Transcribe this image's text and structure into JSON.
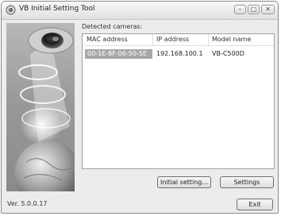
{
  "window": {
    "title": "VB Initial Setting Tool",
    "controls": {
      "minimize": "–",
      "maximize": "□",
      "close": "✕"
    }
  },
  "main": {
    "detected_label": "Detected cameras:",
    "columns": [
      "MAC address",
      "IP address",
      "Model name"
    ],
    "rows": [
      {
        "mac": "00-1E-8F-06-50-5E",
        "ip": "192.168.100.1",
        "model": "VB-C500D",
        "selected": true
      }
    ]
  },
  "buttons": {
    "initial_setting": "Initial setting...",
    "settings": "Settings",
    "exit": "Exit"
  },
  "footer": {
    "version": "Ver. 5.0.0.17"
  },
  "icons": {
    "app": "camera-icon",
    "minimize": "minimize-icon",
    "maximize": "maximize-icon",
    "close": "close-icon"
  },
  "colors": {
    "selection": "#a8a8a8",
    "window_bg": "#ececec"
  }
}
